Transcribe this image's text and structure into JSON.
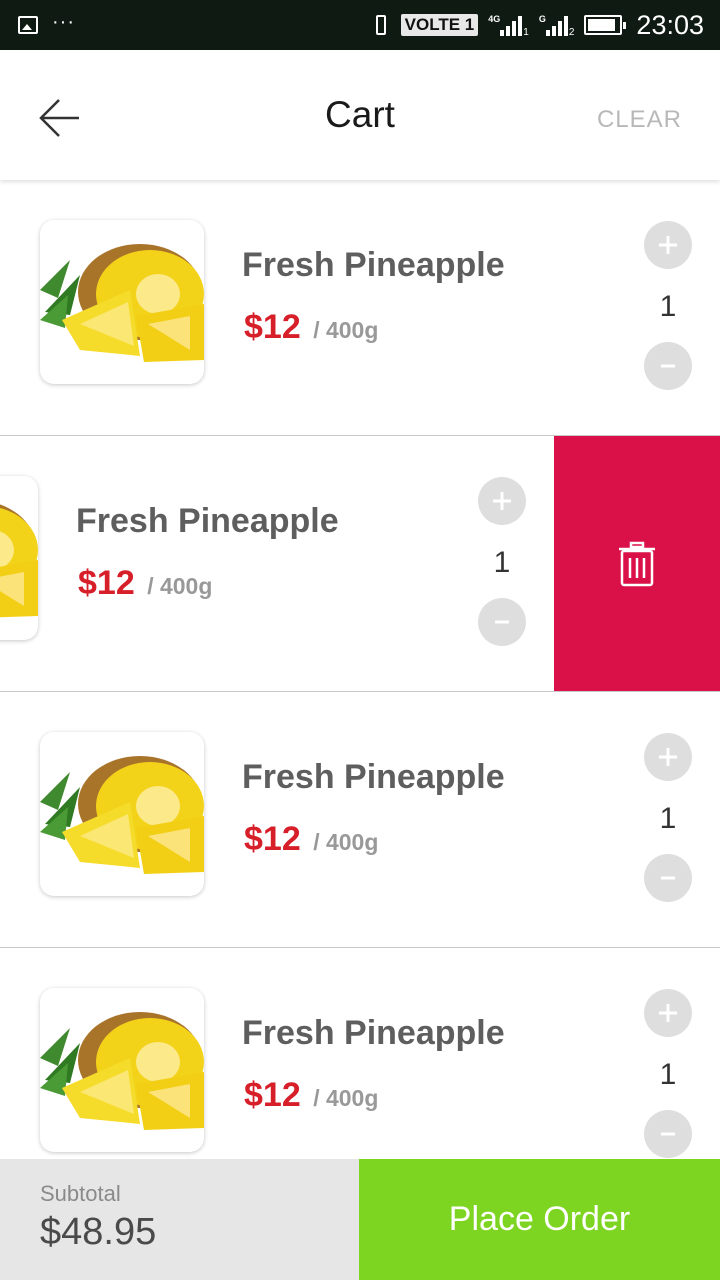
{
  "status_bar": {
    "volte": "VOLTE 1",
    "net1": "4G",
    "sim1": "1",
    "net2": "G",
    "sim2": "2",
    "battery_level": 0.9,
    "time": "23:03"
  },
  "header": {
    "title": "Cart",
    "clear_label": "CLEAR",
    "back_icon": "arrow-left-icon"
  },
  "cart": {
    "items": [
      {
        "name": "Fresh Pineapple",
        "price": "$12",
        "unit": "/ 400g",
        "quantity": "1"
      },
      {
        "name": "Fresh Pineapple",
        "price": "$12",
        "unit": "/ 400g",
        "quantity": "1"
      },
      {
        "name": "Fresh Pineapple",
        "price": "$12",
        "unit": "/ 400g",
        "quantity": "1"
      },
      {
        "name": "Fresh Pineapple",
        "price": "$12",
        "unit": "/ 400g",
        "quantity": "1"
      }
    ],
    "plus_icon": "plus-icon",
    "minus_icon": "minus-icon",
    "delete_icon": "trash-icon"
  },
  "footer": {
    "subtotal_label": "Subtotal",
    "subtotal_value": "$48.95",
    "place_order_label": "Place Order"
  },
  "colors": {
    "accent_green": "#7dd421",
    "price_red": "#d71f2a",
    "delete_red": "#da1149",
    "status_bar": "#0e1a12"
  }
}
